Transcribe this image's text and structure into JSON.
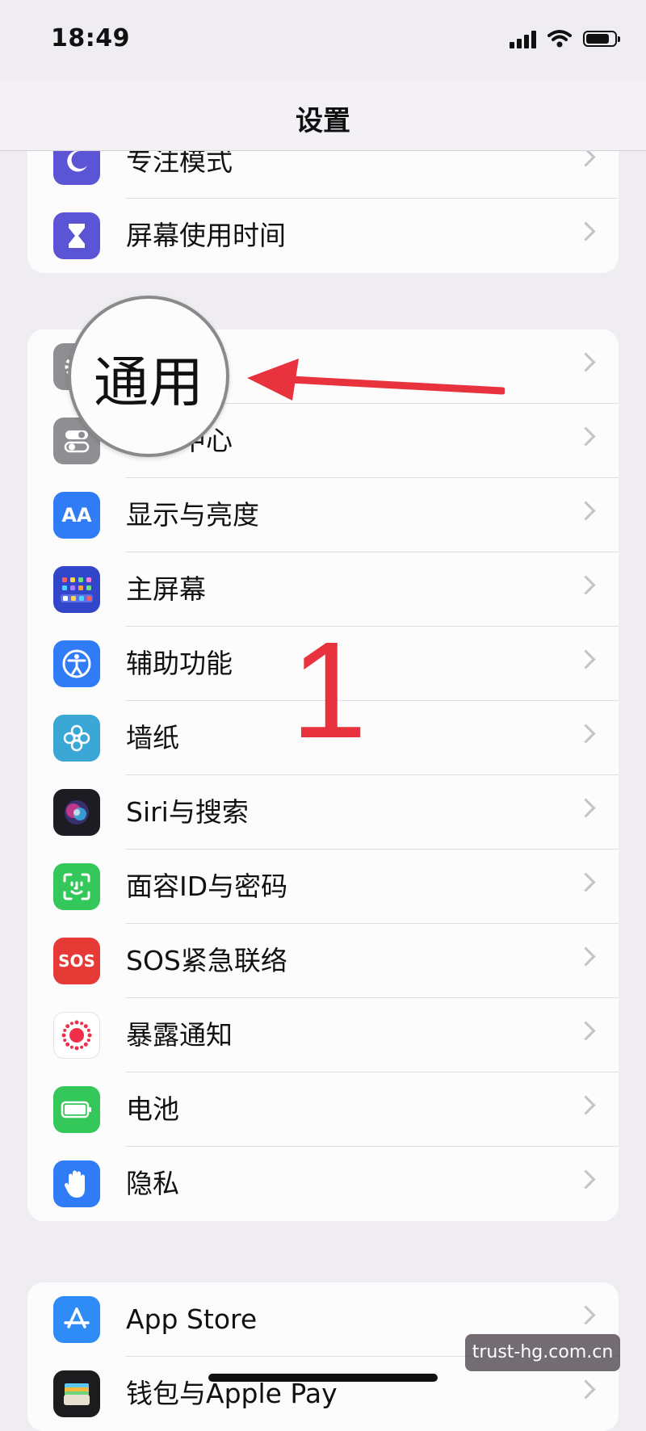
{
  "status_bar": {
    "time": "18:49",
    "icons": [
      "signal-icon",
      "wifi-icon",
      "battery-icon"
    ]
  },
  "nav": {
    "title": "设置"
  },
  "group1": {
    "items": [
      {
        "label": "专注模式",
        "icon": "moon-icon",
        "color": "#5b55d6"
      },
      {
        "label": "屏幕使用时间",
        "icon": "hourglass-icon",
        "color": "#5b55d6"
      }
    ]
  },
  "group2": {
    "items": [
      {
        "label": "通用",
        "icon": "gear-icon",
        "color": "#8e8e93"
      },
      {
        "label": "控制中心",
        "icon": "toggles-icon",
        "color": "#8e8e93"
      },
      {
        "label": "显示与亮度",
        "icon": "aa-icon",
        "icon_text": "AA",
        "color": "#2f7cf6"
      },
      {
        "label": "主屏幕",
        "icon": "home-grid-icon",
        "color": "#3146c8"
      },
      {
        "label": "辅助功能",
        "icon": "accessibility-icon",
        "color": "#2f7cf6"
      },
      {
        "label": "墙纸",
        "icon": "flower-icon",
        "color": "#3aa7d6"
      },
      {
        "label": "Siri与搜索",
        "icon": "siri-icon",
        "color": "#222"
      },
      {
        "label": "面容ID与密码",
        "icon": "face-id-icon",
        "color": "#34c759"
      },
      {
        "label": "SOS紧急联络",
        "icon": "sos-icon",
        "icon_text": "SOS",
        "color": "#e53a35"
      },
      {
        "label": "暴露通知",
        "icon": "exposure-icon",
        "color": "#ffffff"
      },
      {
        "label": "电池",
        "icon": "battery-green-icon",
        "color": "#34c759"
      },
      {
        "label": "隐私",
        "icon": "hand-icon",
        "color": "#2f7cf6"
      }
    ]
  },
  "group3": {
    "items": [
      {
        "label": "App Store",
        "icon": "app-store-icon",
        "color": "#2f8cf6"
      },
      {
        "label": "钱包与Apple Pay",
        "icon": "wallet-icon",
        "color": "#222"
      }
    ]
  },
  "annotations": {
    "magnifier_text": "通用",
    "number": "1",
    "arrow_color": "#e8333e"
  },
  "watermark": "trust-hg.com.cn"
}
